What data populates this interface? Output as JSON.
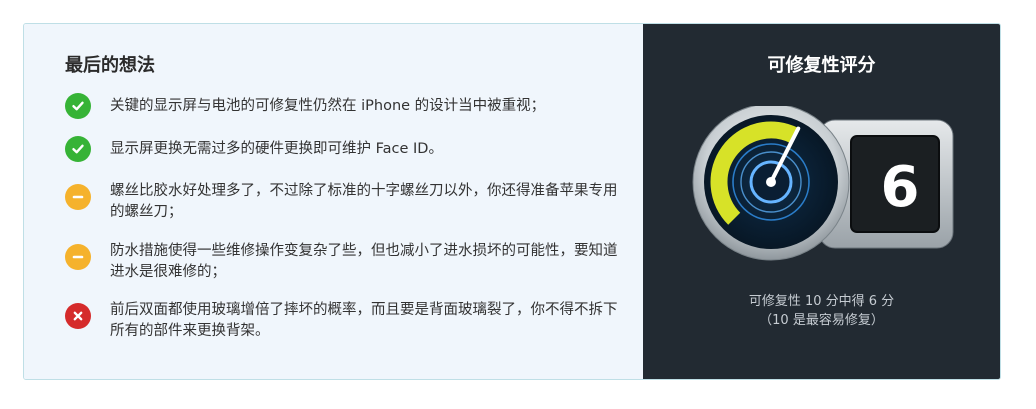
{
  "final_thoughts": {
    "title": "最后的想法",
    "items": [
      {
        "status": "pass",
        "icon": "check-icon",
        "text": "关键的显示屏与电池的可修复性仍然在 iPhone 的设计当中被重视；"
      },
      {
        "status": "pass",
        "icon": "check-icon",
        "text": "显示屏更换无需过多的硬件更换即可维护 Face ID。"
      },
      {
        "status": "warn",
        "icon": "minus-icon",
        "text": "螺丝比胶水好处理多了，不过除了标准的十字螺丝刀以外，你还得准备苹果专用的螺丝刀；"
      },
      {
        "status": "warn",
        "icon": "minus-icon",
        "text": "防水措施使得一些维修操作变复杂了些，但也减小了进水损坏的可能性，要知道进水是很难修的；"
      },
      {
        "status": "fail",
        "icon": "x-icon",
        "text": "前后双面都使用玻璃增倍了摔坏的概率，而且要是背面玻璃裂了，你不得不拆下所有的部件来更换背架。"
      }
    ]
  },
  "repairability": {
    "title": "可修复性评分",
    "score": "6",
    "score_value": 6,
    "score_max": 10,
    "caption_line1": "可修复性 10 分中得 6 分",
    "caption_line2": "（10 是最容易修复）"
  },
  "colors": {
    "pass": "#36b336",
    "warn": "#f5b22c",
    "fail": "#d52b2b",
    "gauge_arc": "#d7e228",
    "panel_bg": "#222a32"
  }
}
